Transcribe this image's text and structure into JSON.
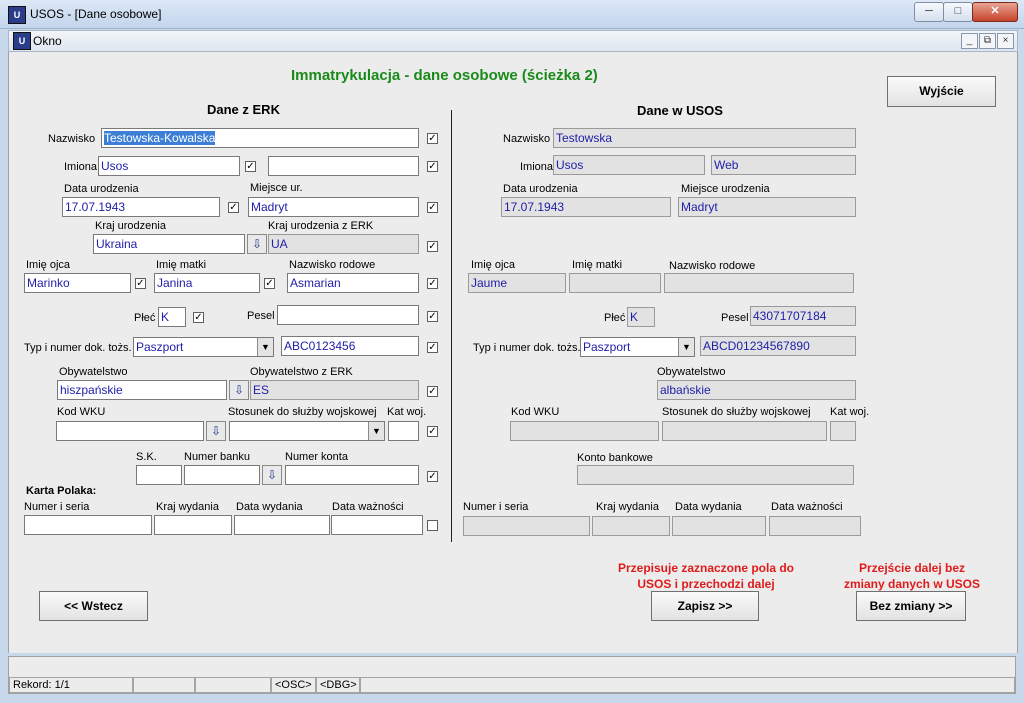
{
  "window": {
    "title": "USOS - [Dane osobowe]",
    "app_icon": "usos-icon",
    "minimize": "─",
    "maximize": "□",
    "close": "✕"
  },
  "menubar": {
    "label": "Okno",
    "minimize": "_",
    "restore": "⧉",
    "close": "×"
  },
  "form": {
    "title": "Immatrykulacja - dane osobowe (ścieżka 2)",
    "exit_button": "Wyjście",
    "erk_header": "Dane z ERK",
    "usos_header": "Dane w USOS"
  },
  "erk": {
    "nazwisko_label": "Nazwisko",
    "nazwisko": "Testowska-Kowalska",
    "imiona_label": "Imiona",
    "imie1": "Usos",
    "imie2": "",
    "data_ur_label": "Data urodzenia",
    "data_ur": "17.07.1943",
    "miejsce_ur_label": "Miejsce ur.",
    "miejsce_ur": "Madryt",
    "kraj_ur_label": "Kraj urodzenia",
    "kraj_ur": "Ukraina",
    "kraj_ur_erk_label": "Kraj urodzenia z ERK",
    "kraj_ur_erk": "UA",
    "imie_ojca_label": "Imię ojca",
    "imie_ojca": "Marinko",
    "imie_matki_label": "Imię matki",
    "imie_matki": "Janina",
    "nazwisko_rod_label": "Nazwisko rodowe",
    "nazwisko_rod": "Asmarian",
    "plec_label": "Płeć",
    "plec": "K",
    "pesel_label": "Pesel",
    "pesel": "",
    "typ_dok_label": "Typ i numer dok. tożs.",
    "typ_dok": "Paszport",
    "nr_dok": "ABC0123456",
    "obyw_label": "Obywatelstwo",
    "obyw": "hiszpańskie",
    "obyw_erk_label": "Obywatelstwo z ERK",
    "obyw_erk": "ES",
    "kod_wku_label": "Kod WKU",
    "kod_wku": "",
    "stosunek_label": "Stosunek do służby wojskowej",
    "stosunek": "",
    "kat_woj_label": "Kat woj.",
    "kat_woj": "",
    "sk_label": "S.K.",
    "sk": "",
    "nr_banku_label": "Numer banku",
    "nr_banku": "",
    "nr_konta_label": "Numer konta",
    "nr_konta": "",
    "karta_label": "Karta Polaka:",
    "kp_numer_label": "Numer i seria",
    "kp_kraj_label": "Kraj wydania",
    "kp_data_wyd_label": "Data wydania",
    "kp_data_waz_label": "Data ważności"
  },
  "usos": {
    "nazwisko_label": "Nazwisko",
    "nazwisko": "Testowska",
    "imiona_label": "Imiona",
    "imie1": "Usos",
    "imie2": "Web",
    "data_ur_label": "Data urodzenia",
    "data_ur": "17.07.1943",
    "miejsce_ur_label": "Miejsce urodzenia",
    "miejsce_ur": "Madryt",
    "imie_ojca_label": "Imię ojca",
    "imie_ojca": "Jaume",
    "imie_matki_label": "Imię matki",
    "imie_matki": "",
    "nazwisko_rod_label": "Nazwisko rodowe",
    "nazwisko_rod": "",
    "plec_label": "Płeć",
    "plec": "K",
    "pesel_label": "Pesel",
    "pesel": "43071707184",
    "typ_dok_label": "Typ i numer dok. tożs.",
    "typ_dok": "Paszport",
    "nr_dok": "ABCD01234567890",
    "obyw_label": "Obywatelstwo",
    "obyw": "albańskie",
    "kod_wku_label": "Kod WKU",
    "stosunek_label": "Stosunek do służby wojskowej",
    "kat_woj_label": "Kat woj.",
    "konto_label": "Konto bankowe",
    "kp_numer_label": "Numer i seria",
    "kp_kraj_label": "Kraj wydania",
    "kp_data_wyd_label": "Data wydania",
    "kp_data_waz_label": "Data ważności"
  },
  "actions": {
    "back": "<< Wstecz",
    "save_note": "Przepisuje zaznaczone pola do USOS i przechodzi dalej",
    "save": "Zapisz >>",
    "skip_note": "Przejście dalej bez zmiany danych w USOS",
    "skip": "Bez zmiany >>"
  },
  "checkbox_mark": "✓",
  "lov_icon_glyph": "⇩",
  "dropdown_glyph": "▼",
  "status": {
    "record": "Rekord: 1/1",
    "osc": "<OSC>",
    "dbg": "<DBG>"
  },
  "colors": {
    "title_green": "#1a8a1a",
    "value_blue": "#1e1ea8",
    "note_red": "#e01b1b"
  }
}
